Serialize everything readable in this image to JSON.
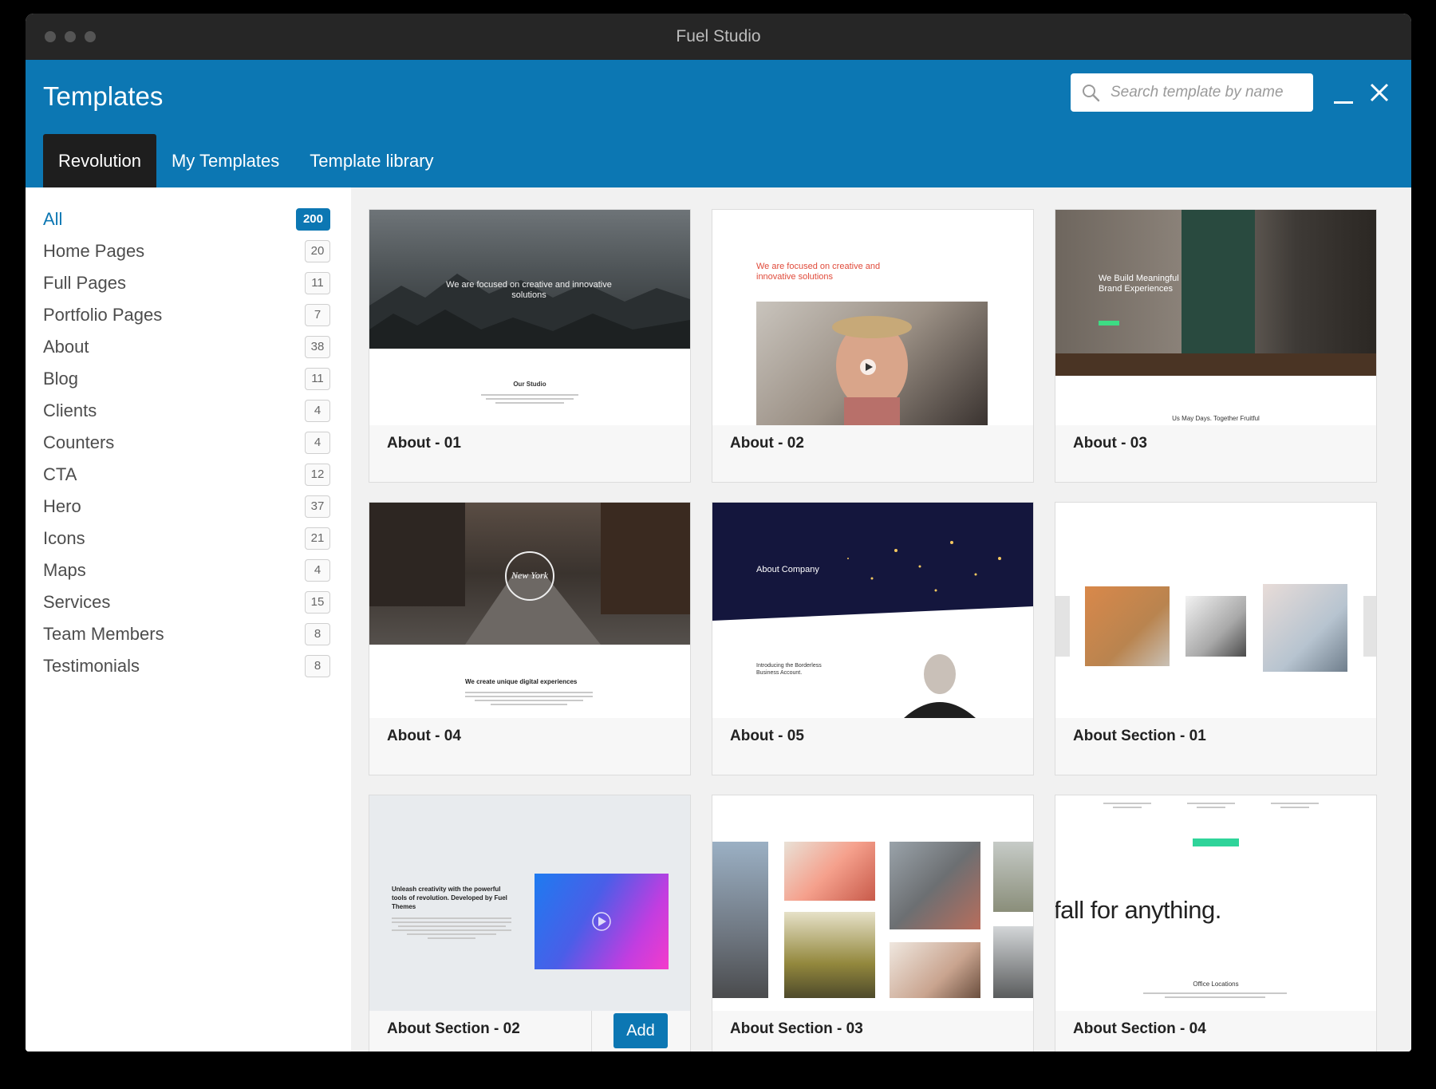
{
  "window": {
    "title": "Fuel Studio"
  },
  "header": {
    "title": "Templates",
    "search_placeholder": "Search template by name",
    "tabs": [
      {
        "label": "Revolution",
        "active": true
      },
      {
        "label": "My Templates",
        "active": false
      },
      {
        "label": "Template library",
        "active": false
      }
    ]
  },
  "colors": {
    "accent": "#0c77b3",
    "titlebar": "#262626",
    "active_tab": "#1e1e1e"
  },
  "sidebar": {
    "categories": [
      {
        "label": "All",
        "count": "200",
        "active": true
      },
      {
        "label": "Home Pages",
        "count": "20"
      },
      {
        "label": "Full Pages",
        "count": "11"
      },
      {
        "label": "Portfolio Pages",
        "count": "7"
      },
      {
        "label": "About",
        "count": "38"
      },
      {
        "label": "Blog",
        "count": "11"
      },
      {
        "label": "Clients",
        "count": "4"
      },
      {
        "label": "Counters",
        "count": "4"
      },
      {
        "label": "CTA",
        "count": "12"
      },
      {
        "label": "Hero",
        "count": "37"
      },
      {
        "label": "Icons",
        "count": "21"
      },
      {
        "label": "Maps",
        "count": "4"
      },
      {
        "label": "Services",
        "count": "15"
      },
      {
        "label": "Team Members",
        "count": "8"
      },
      {
        "label": "Testimonials",
        "count": "8"
      }
    ]
  },
  "templates": [
    {
      "name": "About - 01",
      "headline": "We are focused on creative and innovative solutions",
      "subhead": "Our Studio"
    },
    {
      "name": "About - 02",
      "headline": "We are focused on creative and innovative solutions"
    },
    {
      "name": "About - 03",
      "headline": "We Build Meaningful Brand Experiences",
      "subhead": "Us May Days. Together Fruitful"
    },
    {
      "name": "About - 04",
      "subhead": "We create unique digital experiences",
      "badge_text": "New York"
    },
    {
      "name": "About - 05",
      "headline": "About Company",
      "subhead": "Introducing the Borderless Business Account."
    },
    {
      "name": "About Section - 01"
    },
    {
      "name": "About Section - 02",
      "headline": "Unleash creativity with the powerful tools of revolution. Developed by Fuel Themes",
      "add_label": "Add"
    },
    {
      "name": "About Section - 03"
    },
    {
      "name": "About Section - 04",
      "headline": "fall for anything.",
      "subhead": "Office Locations"
    }
  ]
}
